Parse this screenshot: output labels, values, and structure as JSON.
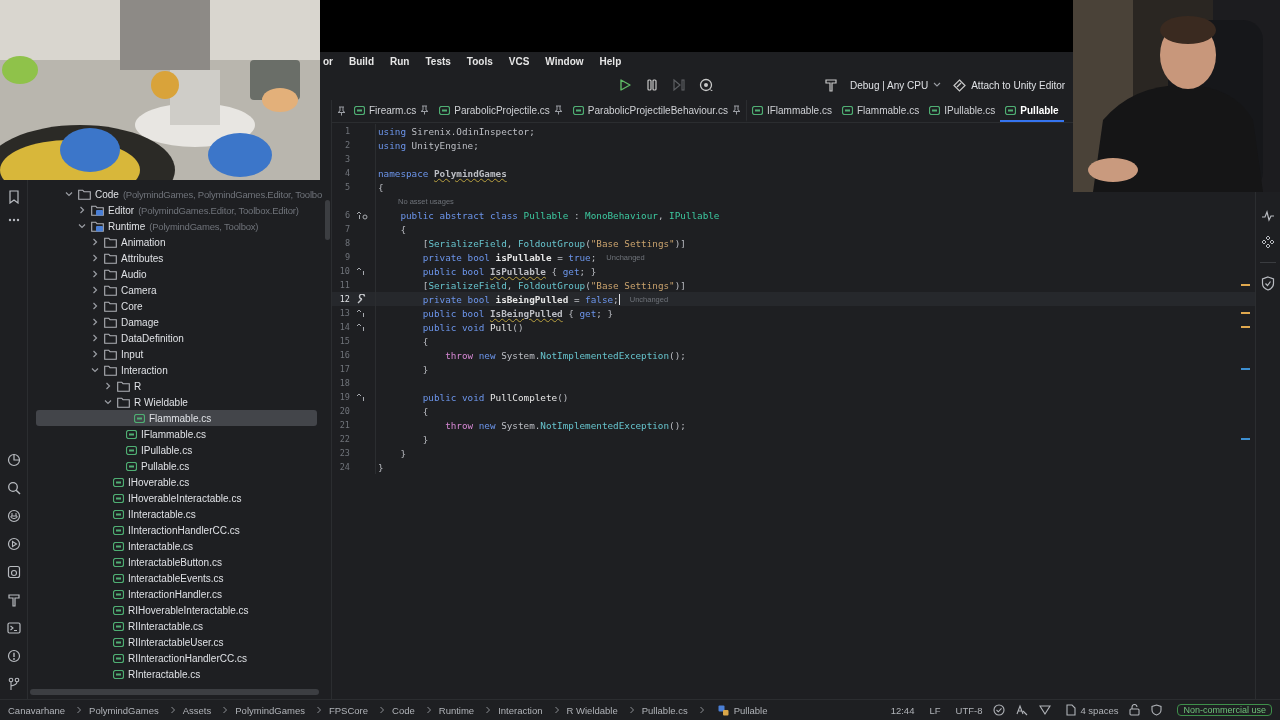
{
  "menu": [
    {
      "label": "or"
    },
    {
      "label": "Build"
    },
    {
      "label": "Run"
    },
    {
      "label": "Tests"
    },
    {
      "label": "Tools"
    },
    {
      "label": "VCS"
    },
    {
      "label": "Window"
    },
    {
      "label": "Help"
    }
  ],
  "toolbar": {
    "run_config": "Debug | Any CPU",
    "attach": "Attach to Unity Editor"
  },
  "tabs": [
    {
      "label": "Firearm.cs",
      "pinned": true,
      "selected": false
    },
    {
      "label": "ParabolicProjectile.cs",
      "pinned": true,
      "selected": false
    },
    {
      "label": "ParabolicProjectileBehaviour.cs",
      "pinned": true,
      "selected": false
    },
    {
      "label": "IFlammable.cs",
      "pinned": false,
      "selected": false
    },
    {
      "label": "Flammable.cs",
      "pinned": false,
      "selected": false
    },
    {
      "label": "IPullable.cs",
      "pinned": false,
      "selected": false
    },
    {
      "label": "Pullable",
      "pinned": false,
      "selected": true
    }
  ],
  "tree": [
    {
      "label": "Code",
      "hint": "(PolymindGames, PolymindGames.Editor, Toolbo",
      "kind": "folder",
      "expanded": true,
      "selected": false,
      "children": [
        {
          "label": "Editor",
          "hint": "(PolymindGames.Editor, Toolbox.Editor)",
          "kind": "module",
          "expanded": false,
          "selected": false
        },
        {
          "label": "Runtime",
          "hint": "(PolymindGames, Toolbox)",
          "kind": "module",
          "expanded": true,
          "selected": false,
          "children": [
            {
              "label": "Animation",
              "kind": "folder",
              "expanded": false,
              "selected": false
            },
            {
              "label": "Attributes",
              "kind": "folder",
              "expanded": false,
              "selected": false
            },
            {
              "label": "Audio",
              "kind": "folder",
              "expanded": false,
              "selected": false
            },
            {
              "label": "Camera",
              "kind": "folder",
              "expanded": false,
              "selected": false
            },
            {
              "label": "Core",
              "kind": "folder",
              "expanded": false,
              "selected": false
            },
            {
              "label": "Damage",
              "kind": "folder",
              "expanded": false,
              "selected": false
            },
            {
              "label": "DataDefinition",
              "kind": "folder",
              "expanded": false,
              "selected": false
            },
            {
              "label": "Input",
              "kind": "folder",
              "expanded": false,
              "selected": false
            },
            {
              "label": "Interaction",
              "kind": "folder",
              "expanded": true,
              "selected": false,
              "children": [
                {
                  "label": "R",
                  "kind": "folder",
                  "expanded": false,
                  "selected": false
                },
                {
                  "label": "R Wieldable",
                  "kind": "folder",
                  "expanded": true,
                  "selected": false,
                  "children": [
                    {
                      "label": "Flammable.cs",
                      "kind": "file",
                      "selected": true
                    },
                    {
                      "label": "IFlammable.cs",
                      "kind": "file",
                      "selected": false
                    },
                    {
                      "label": "IPullable.cs",
                      "kind": "file",
                      "selected": false
                    },
                    {
                      "label": "Pullable.cs",
                      "kind": "file",
                      "selected": false
                    }
                  ]
                },
                {
                  "label": "IHoverable.cs",
                  "kind": "file",
                  "selected": false
                },
                {
                  "label": "IHoverableInteractable.cs",
                  "kind": "file",
                  "selected": false
                },
                {
                  "label": "IInteractable.cs",
                  "kind": "file",
                  "selected": false
                },
                {
                  "label": "IInteractionHandlerCC.cs",
                  "kind": "file",
                  "selected": false
                },
                {
                  "label": "Interactable.cs",
                  "kind": "file",
                  "selected": false
                },
                {
                  "label": "InteractableButton.cs",
                  "kind": "file",
                  "selected": false
                },
                {
                  "label": "InteractableEvents.cs",
                  "kind": "file",
                  "selected": false
                },
                {
                  "label": "InteractionHandler.cs",
                  "kind": "file",
                  "selected": false
                },
                {
                  "label": "RIHoverableInteractable.cs",
                  "kind": "file",
                  "selected": false
                },
                {
                  "label": "RIInteractable.cs",
                  "kind": "file",
                  "selected": false
                },
                {
                  "label": "RIInteractableUser.cs",
                  "kind": "file",
                  "selected": false
                },
                {
                  "label": "RIInteractionHandlerCC.cs",
                  "kind": "file",
                  "selected": false
                },
                {
                  "label": "RInteractable.cs",
                  "kind": "file",
                  "selected": false
                }
              ]
            }
          ]
        }
      ]
    }
  ],
  "lines": [
    {
      "kind": "code",
      "number": "1",
      "current": false,
      "tokens": [
        {
          "text": "using",
          "kind": "kw"
        },
        {
          "text": " Sirenix.OdinInspector;",
          "kind": "plain"
        }
      ]
    },
    {
      "kind": "code",
      "number": "2",
      "current": false,
      "tokens": [
        {
          "text": "using",
          "kind": "kw"
        },
        {
          "text": " UnityEngine;",
          "kind": "plain"
        }
      ]
    },
    {
      "kind": "code",
      "number": "3",
      "current": false
    },
    {
      "kind": "code",
      "number": "4",
      "current": false,
      "tokens": [
        {
          "text": "namespace ",
          "kind": "kw"
        },
        {
          "text": "PolymindGames",
          "kind": "warn"
        }
      ]
    },
    {
      "kind": "code",
      "number": "5",
      "current": false,
      "tokens": [
        {
          "text": "{",
          "kind": "plain"
        }
      ]
    },
    {
      "kind": "hint",
      "text": "No asset usages"
    },
    {
      "kind": "code",
      "number": "6",
      "current": false,
      "gutter": {
        "kind": "implemented"
      },
      "tokens": [
        {
          "text": "    public abstract class ",
          "kind": "kw"
        },
        {
          "text": "Pullable",
          "kind": "type"
        },
        {
          "text": " : ",
          "kind": "plain"
        },
        {
          "text": "MonoBehaviour",
          "kind": "type"
        },
        {
          "text": ", ",
          "kind": "plain"
        },
        {
          "text": "IPullable",
          "kind": "type"
        }
      ]
    },
    {
      "kind": "code",
      "number": "7",
      "current": false,
      "tokens": [
        {
          "text": "    {",
          "kind": "plain"
        }
      ]
    },
    {
      "kind": "code",
      "number": "8",
      "current": false,
      "tokens": [
        {
          "text": "        [",
          "kind": "plain"
        },
        {
          "text": "SerializeField",
          "kind": "attr"
        },
        {
          "text": ", ",
          "kind": "plain"
        },
        {
          "text": "FoldoutGroup",
          "kind": "attr"
        },
        {
          "text": "(",
          "kind": "plain"
        },
        {
          "text": "\"Base Settings\"",
          "kind": "str"
        },
        {
          "text": ")]",
          "kind": "plain"
        }
      ]
    },
    {
      "kind": "code",
      "number": "9",
      "current": false,
      "hint": "Unchanged",
      "tokens": [
        {
          "text": "        private bool ",
          "kind": "kw"
        },
        {
          "text": "isPullable",
          "kind": "field"
        },
        {
          "text": " = ",
          "kind": "plain"
        },
        {
          "text": "true",
          "kind": "kw"
        },
        {
          "text": ";",
          "kind": "plain"
        }
      ]
    },
    {
      "kind": "code",
      "number": "10",
      "current": false,
      "gutter": {
        "kind": "override"
      },
      "tokens": [
        {
          "text": "        public bool ",
          "kind": "kw"
        },
        {
          "text": "IsPullable",
          "kind": "warn"
        },
        {
          "text": " { ",
          "kind": "plain"
        },
        {
          "text": "get",
          "kind": "kw"
        },
        {
          "text": "; }",
          "kind": "plain"
        }
      ]
    },
    {
      "kind": "code",
      "number": "11",
      "current": false,
      "stripe": {
        "kind": "warning"
      },
      "tokens": [
        {
          "text": "        [",
          "kind": "plain"
        },
        {
          "text": "SerializeField",
          "kind": "attr"
        },
        {
          "text": ", ",
          "kind": "plain"
        },
        {
          "text": "FoldoutGroup",
          "kind": "attr"
        },
        {
          "text": "(",
          "kind": "plain"
        },
        {
          "text": "\"Base Settings\"",
          "kind": "str"
        },
        {
          "text": ")]",
          "kind": "plain"
        }
      ]
    },
    {
      "kind": "code",
      "number": "12",
      "current": true,
      "gutter": {
        "kind": "edit"
      },
      "hint": "Unchanged",
      "tokens": [
        {
          "text": "        private bool ",
          "kind": "kw"
        },
        {
          "text": "isBeingPulled",
          "kind": "field"
        },
        {
          "text": " = ",
          "kind": "plain"
        },
        {
          "text": "false",
          "kind": "kw"
        },
        {
          "text": ";",
          "kind": "plain"
        }
      ]
    },
    {
      "kind": "code",
      "number": "13",
      "current": false,
      "gutter": {
        "kind": "override"
      },
      "stripe": {
        "kind": "warning"
      },
      "tokens": [
        {
          "text": "        public bool ",
          "kind": "kw"
        },
        {
          "text": "IsBeingPulled",
          "kind": "warn"
        },
        {
          "text": " { ",
          "kind": "plain"
        },
        {
          "text": "get",
          "kind": "kw"
        },
        {
          "text": "; }",
          "kind": "plain"
        }
      ]
    },
    {
      "kind": "code",
      "number": "14",
      "current": false,
      "gutter": {
        "kind": "override"
      },
      "stripe": {
        "kind": "warning"
      },
      "tokens": [
        {
          "text": "        public void ",
          "kind": "kw"
        },
        {
          "text": "Pull",
          "kind": "method"
        },
        {
          "text": "()",
          "kind": "plain"
        }
      ]
    },
    {
      "kind": "code",
      "number": "15",
      "current": false,
      "tokens": [
        {
          "text": "        {",
          "kind": "plain"
        }
      ]
    },
    {
      "kind": "code",
      "number": "16",
      "current": false,
      "tokens": [
        {
          "text": "            throw ",
          "kind": "ctl"
        },
        {
          "text": "new ",
          "kind": "kw"
        },
        {
          "text": "System.",
          "kind": "plain"
        },
        {
          "text": "NotImplementedException",
          "kind": "attr"
        },
        {
          "text": "();",
          "kind": "plain"
        }
      ]
    },
    {
      "kind": "code",
      "number": "17",
      "current": false,
      "stripe": {
        "kind": "info"
      },
      "tokens": [
        {
          "text": "        }",
          "kind": "plain"
        }
      ]
    },
    {
      "kind": "code",
      "number": "18",
      "current": false
    },
    {
      "kind": "code",
      "number": "19",
      "current": false,
      "gutter": {
        "kind": "override"
      },
      "tokens": [
        {
          "text": "        public void ",
          "kind": "kw"
        },
        {
          "text": "PullComplete",
          "kind": "method"
        },
        {
          "text": "()",
          "kind": "plain"
        }
      ]
    },
    {
      "kind": "code",
      "number": "20",
      "current": false,
      "tokens": [
        {
          "text": "        {",
          "kind": "plain"
        }
      ]
    },
    {
      "kind": "code",
      "number": "21",
      "current": false,
      "tokens": [
        {
          "text": "            throw ",
          "kind": "ctl"
        },
        {
          "text": "new ",
          "kind": "kw"
        },
        {
          "text": "System.",
          "kind": "plain"
        },
        {
          "text": "NotImplementedException",
          "kind": "attr"
        },
        {
          "text": "();",
          "kind": "plain"
        }
      ]
    },
    {
      "kind": "code",
      "number": "22",
      "current": false,
      "stripe": {
        "kind": "info"
      },
      "tokens": [
        {
          "text": "        }",
          "kind": "plain"
        }
      ]
    },
    {
      "kind": "code",
      "number": "23",
      "current": false,
      "tokens": [
        {
          "text": "    }",
          "kind": "plain"
        }
      ]
    },
    {
      "kind": "code",
      "number": "24",
      "current": false,
      "tokens": [
        {
          "text": "}",
          "kind": "plain"
        }
      ]
    }
  ],
  "breadcrumbs": [
    {
      "label": "Canavarhane",
      "kind": "text"
    },
    {
      "label": "PolymindGames",
      "kind": "text"
    },
    {
      "label": "Assets",
      "kind": "text"
    },
    {
      "label": "PolymindGames",
      "kind": "text"
    },
    {
      "label": "FPSCore",
      "kind": "text"
    },
    {
      "label": "Code",
      "kind": "text"
    },
    {
      "label": "Runtime",
      "kind": "text"
    },
    {
      "label": "Interaction",
      "kind": "text"
    },
    {
      "label": "R Wieldable",
      "kind": "text"
    },
    {
      "label": "Pullable.cs",
      "kind": "text"
    },
    {
      "label": "Pullable",
      "kind": "class"
    }
  ],
  "status": {
    "position": "12:44",
    "line_ending": "LF",
    "encoding": "UTF-8",
    "indent": "4 spaces",
    "license": "Non-commercial use"
  }
}
